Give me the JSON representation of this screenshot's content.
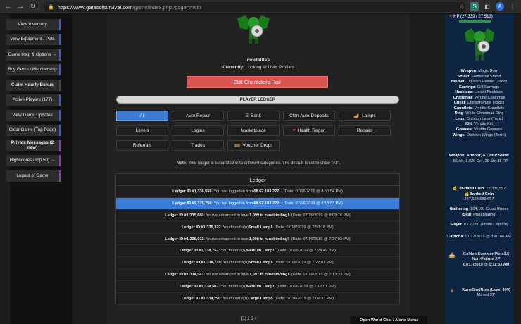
{
  "browser": {
    "url_host": "https://www.gatesofsurvival.com",
    "url_path": "/game/index.php?page=main",
    "avatar_letter": "A"
  },
  "sidebar": {
    "items": [
      {
        "label": "View Inventory"
      },
      {
        "label": "View Equipment / Pets"
      },
      {
        "label": "Game Help & Options →"
      },
      {
        "label": "Buy Gems / Membership"
      },
      {
        "label": "Claim Hourly Bonus"
      },
      {
        "label": "Active Players (177)"
      },
      {
        "label": "View Game Updates"
      },
      {
        "label": "Clear Game (Top Page)"
      },
      {
        "label": "Private Messages (2 new)"
      },
      {
        "label": "Highscores (Top 50) →"
      },
      {
        "label": "Logout of Game"
      }
    ]
  },
  "profile": {
    "name": "mortalites",
    "current_label": "Currently",
    "current_value": ": Looking at User Profiles",
    "hair_button": "Edit Characters Hair"
  },
  "ledger": {
    "bar_label": "PLAYER LEDGER",
    "filters": [
      {
        "label": "All",
        "icon": ""
      },
      {
        "label": "Auto Repair",
        "icon": ""
      },
      {
        "label": "Bank",
        "icon": "$"
      },
      {
        "label": "Clan Auto-Deposits",
        "icon": ""
      },
      {
        "label": "Lamps",
        "icon": "🪔"
      },
      {
        "label": "Levels",
        "icon": ""
      },
      {
        "label": "Logins",
        "icon": ""
      },
      {
        "label": "Marketplace",
        "icon": ""
      },
      {
        "label": "Health Regen",
        "icon": "♥"
      },
      {
        "label": "Repairs",
        "icon": ""
      },
      {
        "label": "Referrals",
        "icon": ""
      },
      {
        "label": "Trades",
        "icon": ""
      },
      {
        "label": "Voucher Drops",
        "icon": "🎟"
      }
    ],
    "note_label": "Note",
    "note_text": ": Your ledger is separated in to different categories. The default is set to show \"All\".",
    "title": "Ledger",
    "rows": [
      {
        "id": "Ledger ID #1,336,556",
        "pre": ": You last logged-in from ",
        "bold": "68.62.103.222",
        "post": ". - (Date: 07/16/2019 @ 8:50:54 PM)"
      },
      {
        "id": "Ledger ID #1,335,750",
        "pre": ": You last logged-in from ",
        "bold": "68.62.103.222",
        "post": ". - (Date: 07/16/2019 @ 8:13:53 PM)"
      },
      {
        "id": "Ledger ID #1,335,680",
        "pre": ": You've advanced to level ",
        "bold": "1,099 in runebinding!",
        "post": " - (Date: 07/16/2019 @ 8:09:16 PM)"
      },
      {
        "id": "Ledger ID #1,335,322",
        "pre": ": You found a(n) ",
        "bold": "Small Lamp!",
        "post": " - (Date: 07/16/2019 @ 7:50:16 PM)"
      },
      {
        "id": "Ledger ID #1,335,011",
        "pre": ": You've advanced to level ",
        "bold": "1,098 in runebinding!",
        "post": " - (Date: 07/16/2019 @ 7:37:03 PM)"
      },
      {
        "id": "Ledger ID #1,334,757",
        "pre": ": You found a(n) ",
        "bold": "Medium Lamp!",
        "post": " - (Date: 07/16/2019 @ 7:24:49 PM)"
      },
      {
        "id": "Ledger ID #1,334,710",
        "pre": ": You found a(n) ",
        "bold": "Small Lamp!",
        "post": " - (Date: 07/16/2019 @ 7:22:02 PM)"
      },
      {
        "id": "Ledger ID #1,334,541",
        "pre": ": You've advanced to level ",
        "bold": "1,097 in runebinding!",
        "post": " - (Date: 07/16/2019 @ 7:13:33 PM)"
      },
      {
        "id": "Ledger ID #1,334,507",
        "pre": ": You found a(n) ",
        "bold": "Medium Lamp!",
        "post": " - (Date: 07/16/2019 @ 7:12:01 PM)"
      },
      {
        "id": "Ledger ID #1,334,290",
        "pre": ": You found a(n) ",
        "bold": "Large Lamp!",
        "post": " - (Date: 07/16/2019 @ 7:02:33 PM)"
      }
    ],
    "pager_current": "[1]",
    "pager_rest": " 2 3 4"
  },
  "chat_bar": "Open World Chat / Alerts Menu",
  "right_panel": {
    "hp": "HP (27,339 / 27,513)",
    "equipment": [
      {
        "k": "Weapon",
        "v": ": Magic Bow"
      },
      {
        "k": "Shield",
        "v": ": Elemental Shield"
      },
      {
        "k": "Helmet",
        "v": ": Oblivion Helmet (Toxic)"
      },
      {
        "k": "Earrings",
        "v": ": Gift Earrings"
      },
      {
        "k": "Necklace",
        "v": ": Locust Necklace"
      },
      {
        "k": "Chainmail",
        "v": ": Verdite Chainmail"
      },
      {
        "k": "Chest",
        "v": ": Oblivion Plate (Toxic)"
      },
      {
        "k": "Gauntlets",
        "v": ": Verdite Gauntlets"
      },
      {
        "k": "Ring",
        "v": ": White Christmas Ring"
      },
      {
        "k": "Legs",
        "v": ": Oblivion Legs (Toxic)"
      },
      {
        "k": "Kilt",
        "v": ": Verdite Kilt"
      },
      {
        "k": "Greaves",
        "v": ": Verdite Greaves"
      },
      {
        "k": "Wings",
        "v": ": Oblivion Wings (Toxic)"
      }
    ],
    "stats_title": "Weapon, Armour, & Outfit Stats",
    "stats_value": "+ 55 Att, 1,826 Def, 38 Str, 35 RP",
    "onhand_label": "On-Hand Coin",
    "onhand_value": ": 15,331,557",
    "banked_label": "Banked Coin",
    "banked_value": "227,623,689,657",
    "gathering_label": "Gathering",
    "gathering_value": ": 104,100 Cloud Runes (",
    "gathering_skill_label": "Skill",
    "gathering_skill_value": ": Runebinding)",
    "slayer_label": "Slayer",
    "slayer_value": ": 0 / 2,050 (Pirate Captain)",
    "captcha_label": "Captcha",
    "captcha_value": ": 07/17/2019 @ 3:40:04 AM",
    "pie_title": "Golden Summer Pie x1.6 Non-Failure XP",
    "pie_date": "07/17/2019 @ 1:11:33 AM",
    "rune_title": "RuneBindNow (Level 499)",
    "rune_sub": "Maxed XP"
  }
}
